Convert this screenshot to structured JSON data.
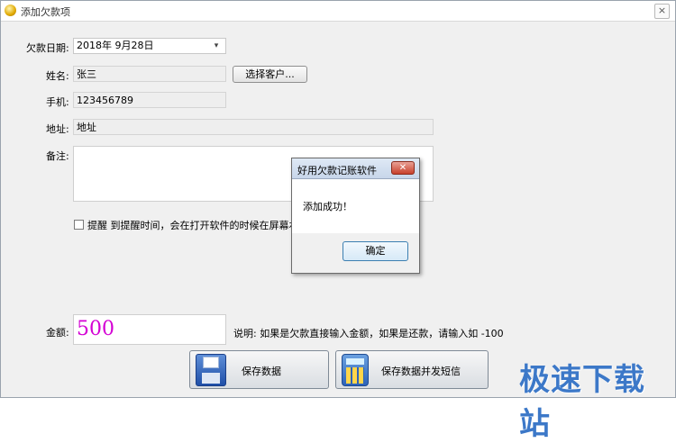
{
  "window": {
    "title": "添加欠款项",
    "close_glyph": "×"
  },
  "form": {
    "date": {
      "label": "欠款日期:",
      "value": "2018年  9月28日",
      "dropdown_glyph": "▾"
    },
    "name": {
      "label": "姓名:",
      "value": "张三"
    },
    "choose_customer_button": "选择客户...",
    "phone": {
      "label": "手机:",
      "value": "123456789"
    },
    "address": {
      "label": "地址:",
      "value": "地址"
    },
    "notes": {
      "label": "备注:",
      "value": ""
    },
    "reminder": {
      "checked": false,
      "text": "提醒 到提醒时间，会在打开软件的时候在屏幕右下角"
    },
    "amount": {
      "label": "金额:",
      "value": "500"
    },
    "hint": "说明: 如果是欠款直接输入金额，如果是还款，请输入如  -100"
  },
  "buttons": {
    "save": "保存数据",
    "save_sms": "保存数据并发短信"
  },
  "dialog": {
    "title": "好用欠款记账软件",
    "close_glyph": "✕",
    "message": "添加成功！",
    "ok_label": "确定"
  },
  "watermark": "极速下载站",
  "colors": {
    "amount_text": "#d400d4",
    "watermark": "#3c78c8",
    "dialog_close": "#c8402c"
  },
  "icons": {
    "app": "coin-icon",
    "save": "floppy-disk-icon",
    "sms": "calculator-icon"
  }
}
